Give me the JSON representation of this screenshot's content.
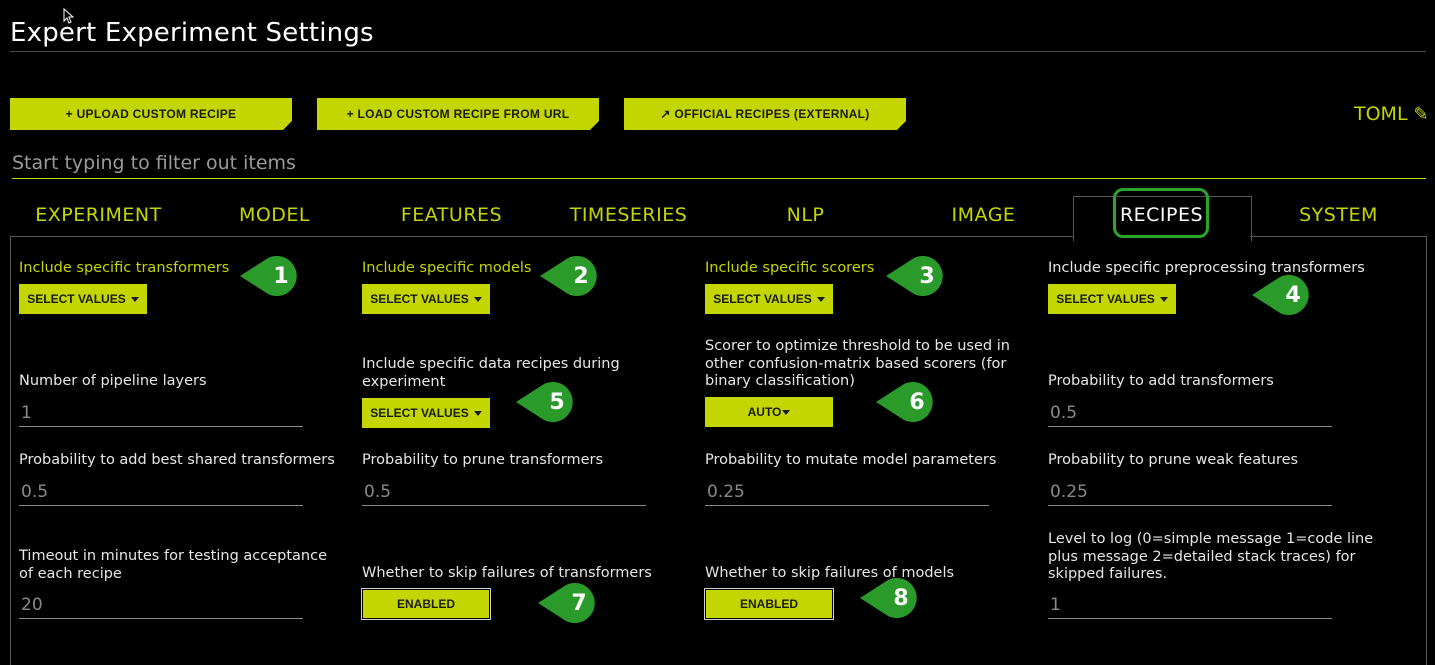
{
  "page": {
    "title": "Expert Experiment Settings"
  },
  "toolbar": {
    "upload_label": "+ UPLOAD CUSTOM RECIPE",
    "load_url_label": "+ LOAD CUSTOM RECIPE FROM URL",
    "official_label": "↗ OFFICIAL RECIPES (EXTERNAL)",
    "toml_label": "TOML",
    "toml_icon": "✎"
  },
  "filter": {
    "placeholder": "Start typing to filter out items"
  },
  "tabs": [
    {
      "label": "EXPERIMENT"
    },
    {
      "label": "MODEL"
    },
    {
      "label": "FEATURES"
    },
    {
      "label": "TIMESERIES"
    },
    {
      "label": "NLP"
    },
    {
      "label": "IMAGE"
    },
    {
      "label": "RECIPES",
      "active": true
    },
    {
      "label": "SYSTEM"
    }
  ],
  "settings": {
    "include_transformers": {
      "label": "Include specific transformers",
      "button": "SELECT VALUES"
    },
    "include_models": {
      "label": "Include specific models",
      "button": "SELECT VALUES"
    },
    "include_scorers": {
      "label": "Include specific scorers",
      "button": "SELECT VALUES"
    },
    "include_preprocessing": {
      "label": "Include specific preprocessing transformers",
      "button": "SELECT VALUES"
    },
    "pipeline_layers": {
      "label": "Number of pipeline layers",
      "value": "1"
    },
    "data_recipes": {
      "label_line1": "Include specific data recipes during",
      "label_line2": "experiment",
      "button": "SELECT VALUES"
    },
    "threshold_scorer": {
      "label_line1": "Scorer to optimize threshold to be used in",
      "label_line2": "other confusion-matrix based scorers (for",
      "label_line3": "binary classification)",
      "button": "AUTO"
    },
    "prob_add_transformers": {
      "label": "Probability to add transformers",
      "value": "0.5"
    },
    "prob_add_best_shared": {
      "label": "Probability to add best shared transformers",
      "value": "0.5"
    },
    "prob_prune_transformers": {
      "label": "Probability to prune transformers",
      "value": "0.5"
    },
    "prob_mutate_params": {
      "label": "Probability to mutate model parameters",
      "value": "0.25"
    },
    "prob_prune_weak": {
      "label": "Probability to prune weak features",
      "value": "0.25"
    },
    "timeout": {
      "label_line1": "Timeout in minutes for testing acceptance",
      "label_line2": "of each recipe",
      "value": "20"
    },
    "skip_transformers": {
      "label": "Whether to skip failures of transformers",
      "button": "ENABLED"
    },
    "skip_models": {
      "label": "Whether to skip failures of models",
      "button": "ENABLED"
    },
    "log_level": {
      "label_line1": "Level to log (0=simple message 1=code line",
      "label_line2": "plus message 2=detailed stack traces) for",
      "label_line3": "skipped failures.",
      "value": "1"
    }
  },
  "callouts": [
    "1",
    "2",
    "3",
    "4",
    "5",
    "6",
    "7",
    "8"
  ],
  "colors": {
    "accent": "#c4d600",
    "callout": "#2a9a2a",
    "background": "#000000"
  }
}
